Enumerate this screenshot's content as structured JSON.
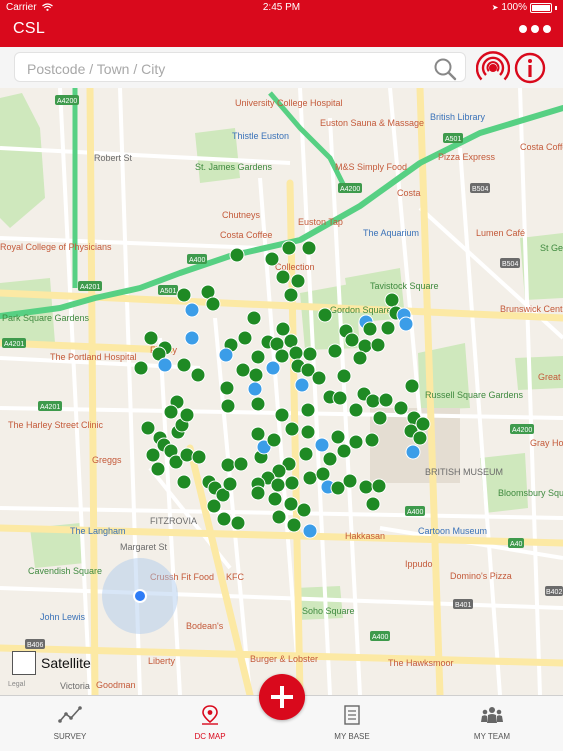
{
  "status_bar": {
    "carrier": "Carrier",
    "time": "2:45 PM",
    "battery": "100%"
  },
  "header": {
    "title": "CSL",
    "more_icon": "more-dots-icon"
  },
  "search": {
    "placeholder": "Postcode / Town / City",
    "value": ""
  },
  "actions": {
    "nearby_icon": "broadcast-icon",
    "info_icon": "info-icon"
  },
  "colors": {
    "brand_red": "#d9091c",
    "marker_green": "#1f8a24",
    "marker_blue": "#3b9de8"
  },
  "map": {
    "satellite_label": "Satellite",
    "legal": "Legal",
    "road_badges": [
      "A4200",
      "A501",
      "A4201",
      "A400",
      "A501",
      "A4200",
      "A4201",
      "A4201",
      "A400",
      "B504",
      "B504",
      "A4200",
      "A40",
      "B401",
      "B406",
      "A400",
      "B402"
    ],
    "labels": {
      "robert_st": "Robert St",
      "st_james_gardens": "St. James Gardens",
      "thistle_euston": "Thistle Euston",
      "university_college_hospital": "University College Hospital",
      "euston_sauna": "Euston Sauna & Massage",
      "british_library": "British Library",
      "ms_simply_food": "M&S Simply Food",
      "pizza_express": "Pizza Express",
      "costa_coffee_top": "Costa Coffe",
      "costa": "Costa",
      "euston_tap": "Euston Tap",
      "the_aquarium": "The Aquarium",
      "lumen_cafe": "Lumen Café",
      "st_ge_gardens": "St Ge Gardens",
      "chutneys": "Chutneys",
      "costa_coffee": "Costa Coffee",
      "royal_college": "Royal College of Physicians",
      "collection": "Collection",
      "gordon_square": "Gordon Square",
      "tavistock_square": "Tavistock Square",
      "brunswick": "Brunswick Centre Market",
      "park_square": "Park Square Gardens",
      "fitzroy": "Fitzroy",
      "portland_hospital": "The Portland Hospital",
      "russell_square": "Russell Square Gardens",
      "great": "Great",
      "harley_street": "The Harley Street Clinic",
      "greggs": "Greggs",
      "british_museum": "BRITISH MUSEUM",
      "gray_holborn": "Gray Holborn",
      "bloomsbury_square": "Bloomsbury Square Gardens",
      "the_langham": "The Langham",
      "fitzrovia": "FITZROVIA",
      "hakkasan": "Hakkasan",
      "cartoon_museum": "Cartoon Museum",
      "cavendish_square": "Cavendish Square",
      "ippudo": "Ippudo",
      "crussh": "Crussh Fit Food",
      "kfc": "KFC",
      "dominos": "Domino's Pizza",
      "john_lewis": "John Lewis",
      "soho_square": "Soho Square",
      "bodeans": "Bodean's",
      "burger_lobster": "Burger & Lobster",
      "the_hawksmoor": "The Hawksmoor",
      "liberty": "Liberty",
      "goodman": "Goodman",
      "victoria": "Victoria",
      "a4200_label": "A4200",
      "mortimer": "Margaret St"
    }
  },
  "tabs": [
    {
      "label": "SURVEY",
      "icon": "survey-chart-icon"
    },
    {
      "label": "DC MAP",
      "icon": "map-pin-icon"
    },
    {
      "label": "MY BASE",
      "icon": "list-document-icon"
    },
    {
      "label": "MY TEAM",
      "icon": "team-people-icon"
    }
  ],
  "add_button": {
    "icon": "plus-icon"
  }
}
